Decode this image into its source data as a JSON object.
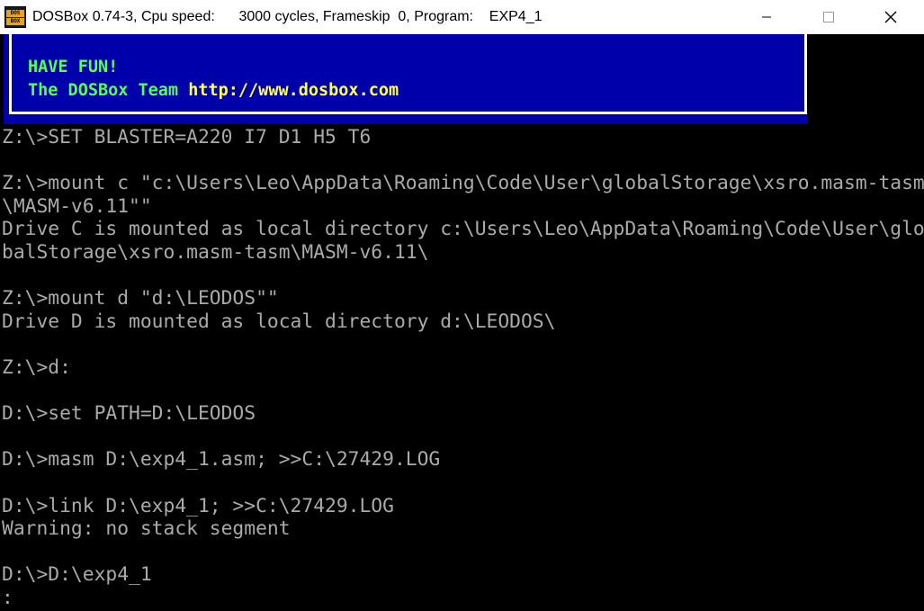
{
  "window": {
    "title": "DOSBox 0.74-3, Cpu speed:      3000 cycles, Frameskip  0, Program:    EXP4_1",
    "icon_label_top": "DOS",
    "icon_label_bottom": "BOX",
    "icon": "dosbox-app-icon",
    "controls": {
      "minimize_icon": "minimize-icon",
      "maximize_icon": "maximize-icon",
      "close_icon": "close-icon"
    }
  },
  "colors": {
    "console_text": "#aaaaaa",
    "console_bg": "#000000",
    "banner_bg": "#0000aa",
    "banner_text": "#55ff55",
    "banner_url": "#ffff55",
    "titlebar_bg": "#ffffff"
  },
  "banner": {
    "line1": "HAVE FUN!",
    "line2_prefix": "The DOSBox Team ",
    "line2_url": "http://www.dosbox.com"
  },
  "console": {
    "lines": [
      "Z:\\>SET BLASTER=A220 I7 D1 H5 T6",
      "",
      "Z:\\>mount c \"c:\\Users\\Leo\\AppData\\Roaming\\Code\\User\\globalStorage\\xsro.masm-tasm",
      "\\MASM-v6.11\"\"",
      "Drive C is mounted as local directory c:\\Users\\Leo\\AppData\\Roaming\\Code\\User\\glo",
      "balStorage\\xsro.masm-tasm\\MASM-v6.11\\",
      "",
      "Z:\\>mount d \"d:\\LEODOS\"\"",
      "Drive D is mounted as local directory d:\\LEODOS\\",
      "",
      "Z:\\>d:",
      "",
      "D:\\>set PATH=D:\\LEODOS",
      "",
      "D:\\>masm D:\\exp4_1.asm; >>C:\\27429.LOG",
      "",
      "D:\\>link D:\\exp4_1; >>C:\\27429.LOG",
      "Warning: no stack segment",
      "",
      "D:\\>D:\\exp4_1",
      ":"
    ]
  }
}
